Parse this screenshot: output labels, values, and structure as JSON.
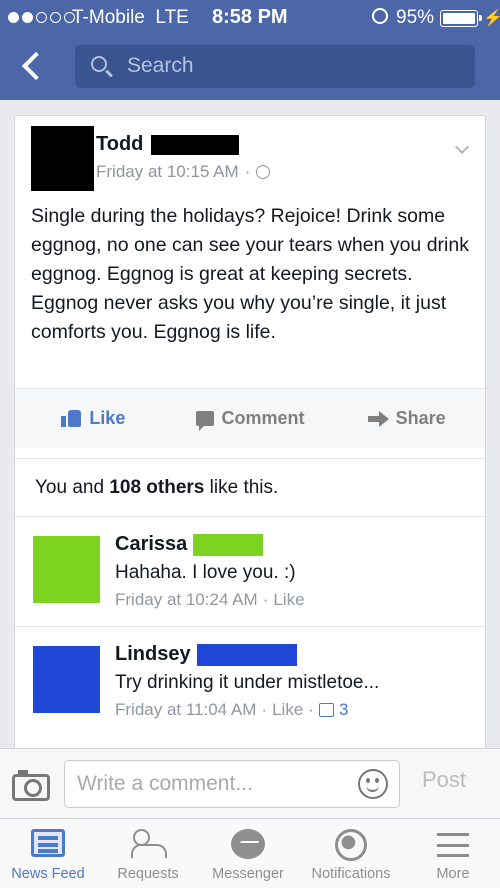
{
  "status_bar": {
    "carrier": "T-Mobile",
    "network": "LTE",
    "time": "8:58 PM",
    "battery": "95%",
    "battery_level": 0.95
  },
  "nav": {
    "search_placeholder": "Search"
  },
  "post": {
    "author": "Todd",
    "timestamp": "Friday at 10:15 AM",
    "separator": "·",
    "text": "Single during the holidays? Rejoice! Drink some eggnog, no one can see your tears when you drink eggnog. Eggnog is great at keeping secrets. Eggnog never asks you why you’re single, it just comforts you. Eggnog is life.",
    "actions": {
      "like": "Like",
      "comment": "Comment",
      "share": "Share"
    },
    "likes": {
      "prefix": "You and ",
      "bold": "108 others",
      "suffix": " like this."
    }
  },
  "comments": [
    {
      "name": "Carissa",
      "text": "Hahaha. I love you. :)",
      "time": "Friday at 10:24 AM",
      "like_label": "Like",
      "avatar_color": "#7ed321",
      "redact_color": "#7ed321"
    },
    {
      "name": "Lindsey",
      "text": "Try drinking it under mistletoe...",
      "time": "Friday at 11:04 AM",
      "like_label": "Like",
      "like_count": "3",
      "avatar_color": "#1f48d8",
      "redact_color": "#1f48d8"
    }
  ],
  "write_comment": {
    "placeholder": "Write a comment...",
    "post_label": "Post"
  },
  "tabs": [
    {
      "label": "News Feed",
      "icon": "news-feed-icon",
      "active": true
    },
    {
      "label": "Requests",
      "icon": "friend-requests-icon",
      "active": false
    },
    {
      "label": "Messenger",
      "icon": "messenger-icon",
      "active": false
    },
    {
      "label": "Notifications",
      "icon": "globe-notifications-icon",
      "active": false
    },
    {
      "label": "More",
      "icon": "menu-icon",
      "active": false
    }
  ],
  "colors": {
    "brand_blue": "#4b67a8",
    "link_blue": "#4c79ca"
  }
}
